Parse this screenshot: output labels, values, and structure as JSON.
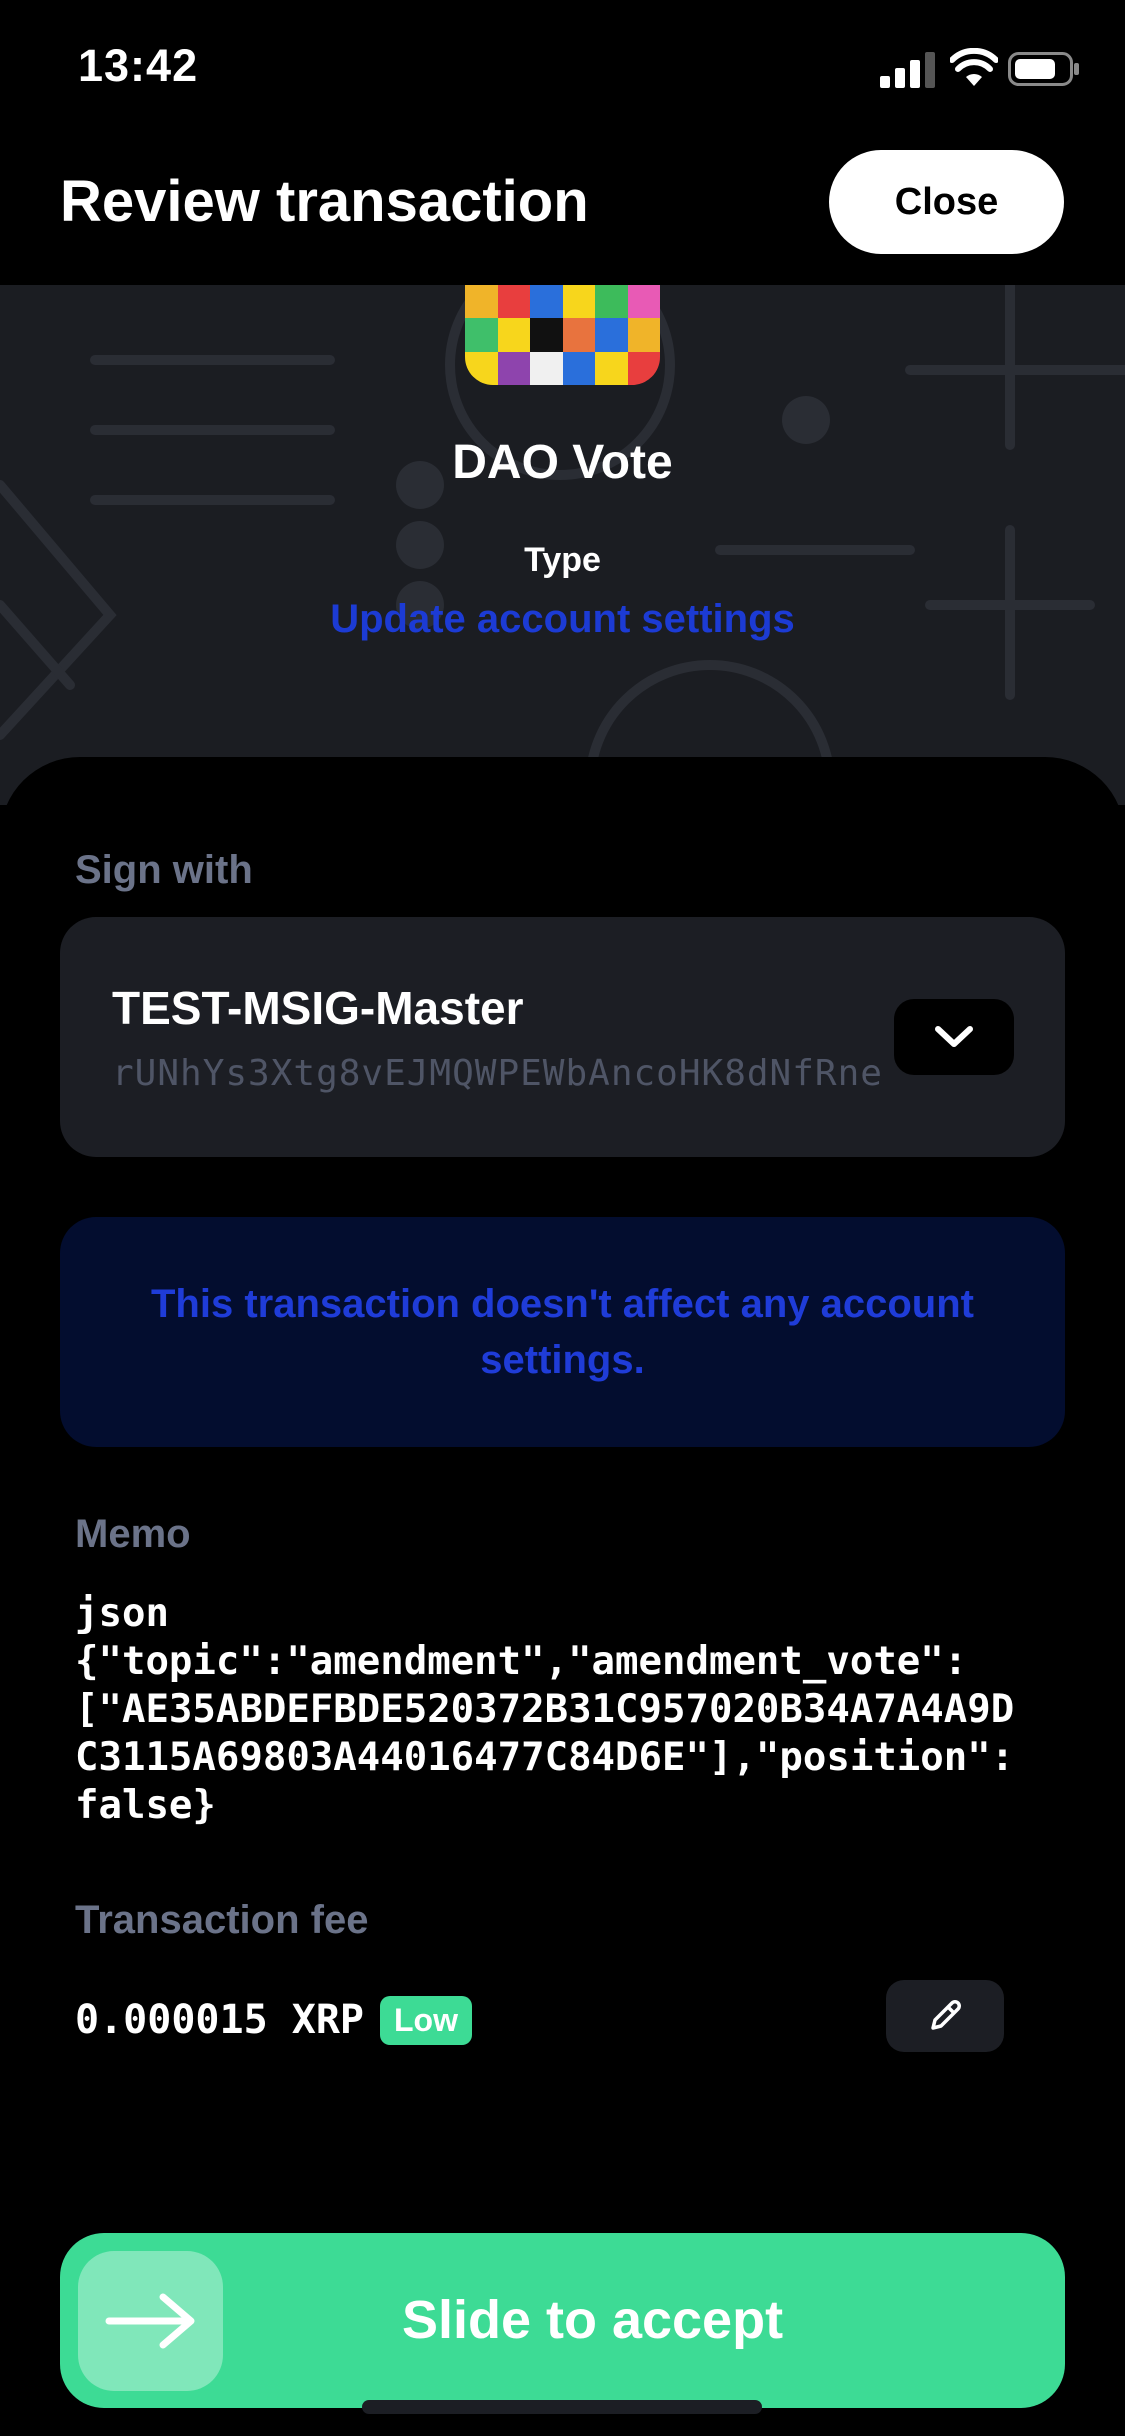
{
  "status_bar": {
    "time": "13:42"
  },
  "header": {
    "title": "Review transaction",
    "close_label": "Close"
  },
  "hero": {
    "app_name": "DAO Vote",
    "type_label": "Type",
    "type_value": "Update account settings"
  },
  "sign_with": {
    "label": "Sign with",
    "account_name": "TEST-MSIG-Master",
    "account_address": "rUNhYs3Xtg8vEJMQWPEWbAncoHK8dNfRne"
  },
  "info": {
    "message": "This transaction doesn't affect any account settings."
  },
  "memo": {
    "label": "Memo",
    "lines": [
      "json",
      "{\"topic\":\"amendment\",\"amendment_vote\":",
      "[\"AE35ABDEFBDE520372B31C957020B34A7A4A9D",
      "C3115A69803A44016477C84D6E\"],\"position\":",
      "false}"
    ]
  },
  "fee": {
    "label": "Transaction fee",
    "value": "0.000015 XRP",
    "badge": "Low"
  },
  "slider": {
    "label": "Slide to accept"
  },
  "colors": {
    "accent_green": "#3ddb95",
    "link_blue": "#1c3bd4",
    "info_bg": "#030d2f",
    "card_bg": "#1c1e24",
    "muted_label": "#6b7389"
  },
  "icons": [
    "signal-icon",
    "wifi-icon",
    "battery-icon",
    "chevron-down-icon",
    "pencil-icon",
    "arrow-right-icon"
  ]
}
